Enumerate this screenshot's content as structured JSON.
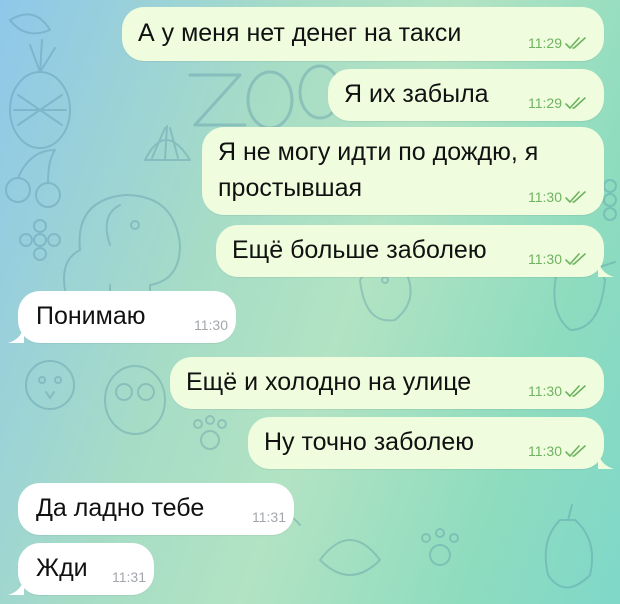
{
  "colors": {
    "outgoing_bubble": "#effdde",
    "incoming_bubble": "#ffffff",
    "outgoing_meta": "#6fb25f",
    "incoming_meta": "#a3a7ab"
  },
  "messages": [
    {
      "direction": "outgoing",
      "text": "А у меня нет денег на такси",
      "time": "11:29",
      "status_icon": "double-check-icon"
    },
    {
      "direction": "outgoing",
      "text": "Я их забыла",
      "time": "11:29",
      "status_icon": "double-check-icon"
    },
    {
      "direction": "outgoing",
      "line1": "Я не могу идти по дождю, я",
      "line2": "простывшая",
      "time": "11:30",
      "status_icon": "double-check-icon"
    },
    {
      "direction": "outgoing",
      "text": "Ещё больше заболею",
      "time": "11:30",
      "status_icon": "double-check-icon"
    },
    {
      "direction": "incoming",
      "text": "Понимаю",
      "time": "11:30"
    },
    {
      "direction": "outgoing",
      "text": "Ещё и холодно на улице",
      "time": "11:30",
      "status_icon": "double-check-icon"
    },
    {
      "direction": "outgoing",
      "text": "Ну точно заболею",
      "time": "11:30",
      "status_icon": "double-check-icon"
    },
    {
      "direction": "incoming",
      "text": "Да ладно тебе",
      "time": "11:31"
    },
    {
      "direction": "incoming",
      "text": "Жди",
      "time": "11:31"
    }
  ]
}
